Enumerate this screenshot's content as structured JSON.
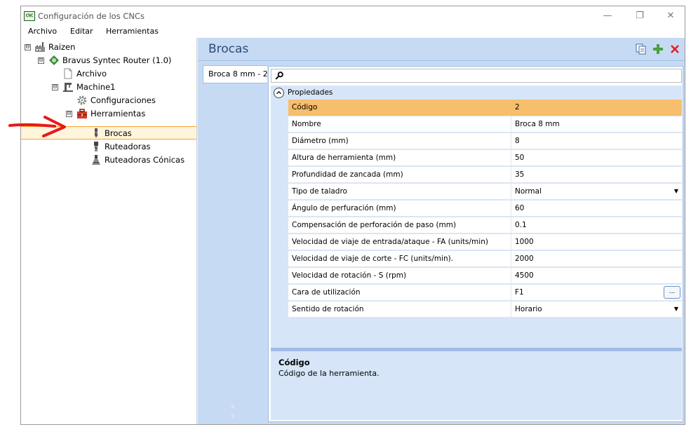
{
  "window": {
    "app_icon_text": "CNC",
    "title": "Configuración de los CNCs",
    "minimize_glyph": "—",
    "maximize_glyph": "❐",
    "close_glyph": "✕"
  },
  "menu": [
    "Archivo",
    "Editar",
    "Herramientas"
  ],
  "tree": {
    "nodes": [
      {
        "label": "Raizen",
        "expander": "⊟",
        "icon": "factory-icon"
      },
      {
        "label": "Bravus Syntec Router (1.0)",
        "expander": "⊟",
        "icon": "router-icon"
      },
      {
        "label": "Archivo",
        "icon": "document-icon"
      },
      {
        "label": "Machine1",
        "expander": "⊟",
        "icon": "machine-icon"
      },
      {
        "label": "Configuraciones",
        "icon": "gear-icon"
      },
      {
        "label": "Herramientas",
        "expander": "⊟",
        "icon": "toolbox-icon"
      },
      {
        "label": "Brocas",
        "icon": "drill-bit-icon",
        "selected": true
      },
      {
        "label": "Ruteadoras",
        "icon": "router-bit-icon"
      },
      {
        "label": "Ruteadoras Cónicas",
        "icon": "conical-bit-icon"
      }
    ]
  },
  "panel": {
    "title": "Brocas",
    "actions": [
      "copy-icon",
      "add-icon",
      "delete-icon"
    ],
    "tab_label": "Broca 8 mm - 2",
    "scroll_up": "▲",
    "scroll_down": "▼"
  },
  "property_grid": {
    "category": "Propiedades",
    "rows": [
      {
        "name": "Código",
        "value": "2"
      },
      {
        "name": "Nombre",
        "value": "Broca 8 mm"
      },
      {
        "name": "Diámetro (mm)",
        "value": "8"
      },
      {
        "name": "Altura de herramienta (mm)",
        "value": "50"
      },
      {
        "name": "Profundidad de zancada (mm)",
        "value": "35"
      },
      {
        "name": "Tipo de taladro",
        "value": "Normal"
      },
      {
        "name": "Ángulo de perfuración (mm)",
        "value": "60"
      },
      {
        "name": "Compensación de perforación de paso (mm)",
        "value": "0.1"
      },
      {
        "name": "Velocidad de viaje de entrada/ataque - FA (units/min)",
        "value": "1000"
      },
      {
        "name": "Velocidad de viaje de corte - FC (units/min).",
        "value": "2000"
      },
      {
        "name": "Velocidad de rotación - S (rpm)",
        "value": "4500"
      },
      {
        "name": "Cara de utilización",
        "value": "F1"
      },
      {
        "name": "Sentido de rotación",
        "value": "Horario"
      }
    ],
    "dropdown_glyph": "▼",
    "ellipsis_label": "...",
    "description_title": "Código",
    "description_text": "Código de la herramienta."
  },
  "colors": {
    "selection_border": "#f6a531",
    "selected_row": "#f7be6b",
    "panel_bg": "#c6daf3",
    "annotation_arrow": "#e81818"
  }
}
